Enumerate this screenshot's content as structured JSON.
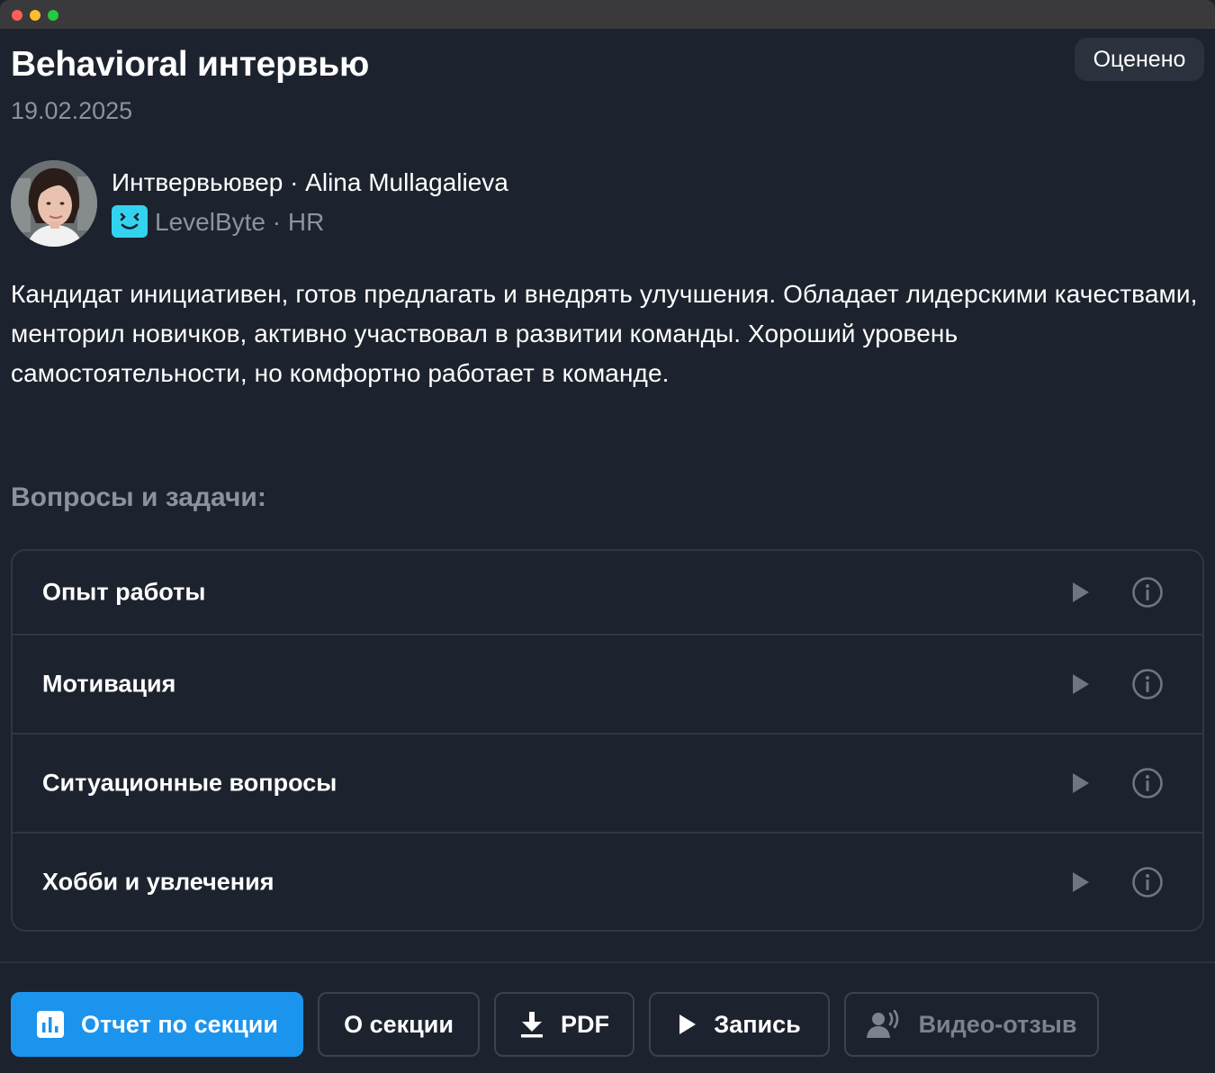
{
  "window": {
    "controls": [
      "close",
      "minimize",
      "zoom"
    ]
  },
  "header": {
    "title": "Behavioral интервью",
    "date": "19.02.2025",
    "status_badge": "Оценено"
  },
  "interviewer": {
    "line": "Интвервьювер · Alina Mullagalieva",
    "company_line": "LevelByte · HR",
    "avatar_icon": "avatar-photo",
    "company_logo_icon": "levelbyte-logo-icon",
    "company_logo_color": "#33d3f0"
  },
  "summary": "Кандидат инициативен, готов предлагать и внедрять улучшения. Обладает лидерскими качествами, менторил новичков, активно участвовал в развитии команды. Хороший уровень самостоятельности, но комфортно работает в команде.",
  "questions": {
    "title": "Вопросы и задачи:",
    "items": [
      {
        "label": "Опыт работы"
      },
      {
        "label": "Мотивация"
      },
      {
        "label": "Ситуационные вопросы"
      },
      {
        "label": "Хобби и увлечения"
      }
    ]
  },
  "actions": {
    "section_report": "Отчет по секции",
    "about_section": "О секции",
    "pdf": "PDF",
    "record": "Запись",
    "video_feedback": "Видео-отзыв"
  },
  "colors": {
    "background": "#1d232e",
    "primary": "#1b94ee",
    "muted_text": "#8c939c",
    "border": "#2f3743"
  }
}
